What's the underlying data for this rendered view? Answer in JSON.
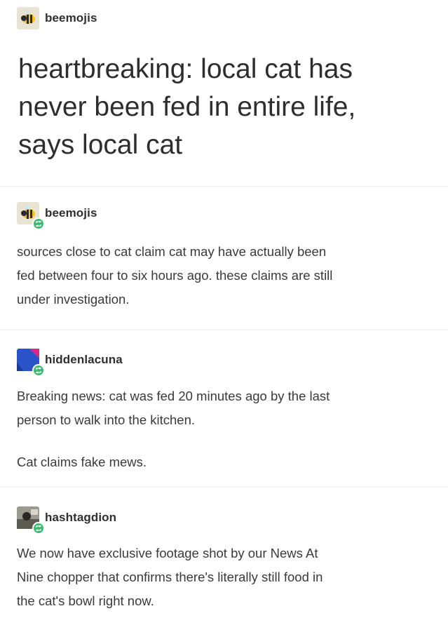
{
  "op": {
    "username": "beemojis",
    "title_lines": [
      "heartbreaking: local cat has",
      "never been fed in entire life,",
      "says local cat"
    ]
  },
  "replies": [
    {
      "username": "beemojis",
      "avatar_icon": "bee-emoji-icon",
      "lines": [
        "sources close to cat claim cat may have actually been",
        "fed between four to six hours ago. these claims are still",
        "under investigation."
      ]
    },
    {
      "username": "hiddenlacuna",
      "avatar_icon": "blue-magenta-avatar-icon",
      "lines": [
        "Breaking news: cat was fed 20 minutes ago by the last",
        "person to walk into the kitchen."
      ],
      "extra": "Cat claims fake mews."
    },
    {
      "username": "hashtagdion",
      "avatar_icon": "photo-avatar-icon",
      "lines": [
        "We now have exclusive footage shot by our News At",
        "Nine chopper that confirms there's literally still food in",
        "the cat's bowl right now."
      ]
    }
  ],
  "colors": {
    "reblog_badge": "#3fb96f",
    "text": "#3a3a3a",
    "separator": "#ebebeb"
  }
}
